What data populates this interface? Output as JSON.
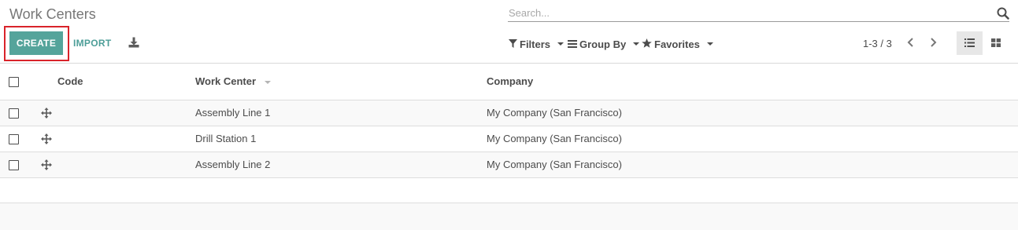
{
  "header": {
    "title": "Work Centers"
  },
  "search": {
    "placeholder": "Search...",
    "value": ""
  },
  "toolbar": {
    "create_label": "CREATE",
    "import_label": "IMPORT"
  },
  "filters": {
    "filters_label": "Filters",
    "group_by_label": "Group By",
    "favorites_label": "Favorites"
  },
  "pager": {
    "value": "1-3 / 3"
  },
  "table": {
    "columns": [
      "Code",
      "Work Center",
      "Company"
    ],
    "rows": [
      {
        "code": "",
        "work_center": "Assembly Line 1",
        "company": "My Company (San Francisco)"
      },
      {
        "code": "",
        "work_center": "Drill Station 1",
        "company": "My Company (San Francisco)"
      },
      {
        "code": "",
        "work_center": "Assembly Line 2",
        "company": "My Company (San Francisco)"
      }
    ]
  },
  "colors": {
    "primary": "#55a49b",
    "import_link": "#4d9e98",
    "highlight_box": "#d9232a",
    "text": "#4c4c4c"
  },
  "icons": [
    "search-icon",
    "download-icon",
    "filter-icon",
    "group-by-icon",
    "star-icon",
    "chevron-left-icon",
    "chevron-right-icon",
    "list-view-icon",
    "kanban-view-icon",
    "drag-handle-icon"
  ]
}
